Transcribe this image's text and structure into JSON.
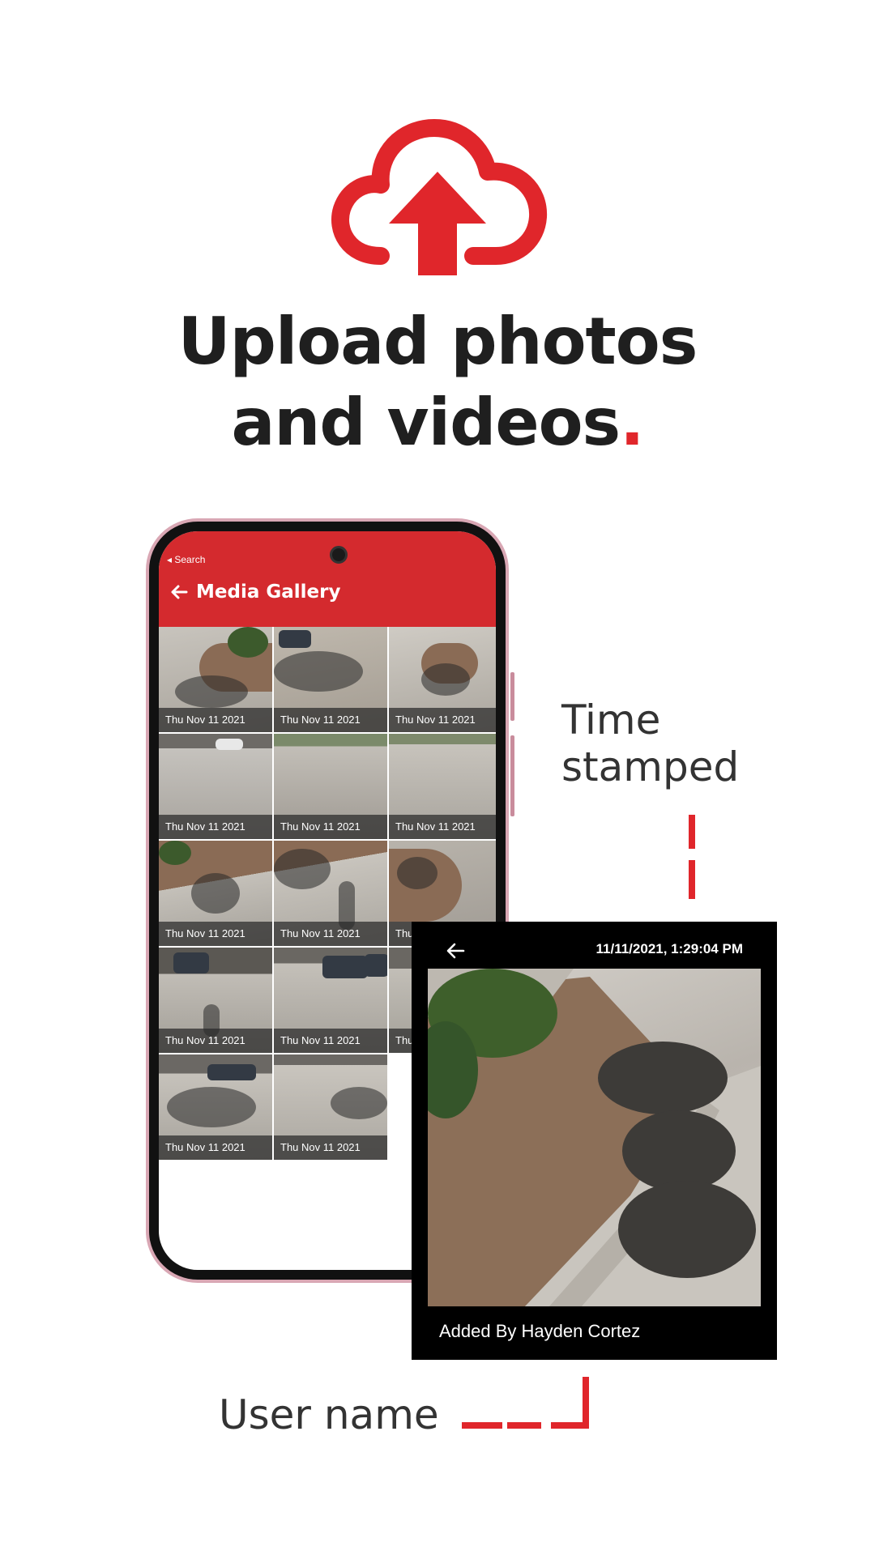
{
  "hero": {
    "icon": "cloud-upload-icon",
    "headline_line1": "Upload photos",
    "headline_line2": "and videos",
    "headline_dot": ".",
    "accent_color": "#e0262b"
  },
  "phone": {
    "status_back_label": "◂ Search",
    "header": {
      "back_icon": "arrow-left-icon",
      "title": "Media Gallery",
      "color": "#d42a2e"
    },
    "gallery": [
      {
        "date": "Thu Nov 11 2021"
      },
      {
        "date": "Thu Nov 11 2021"
      },
      {
        "date": "Thu Nov 11 2021"
      },
      {
        "date": "Thu Nov 11 2021"
      },
      {
        "date": "Thu Nov 11 2021"
      },
      {
        "date": "Thu Nov 11 2021"
      },
      {
        "date": "Thu Nov 11 2021"
      },
      {
        "date": "Thu Nov 11 2021"
      },
      {
        "date": "Thu Nov 11 2021"
      },
      {
        "date": "Thu Nov 11 2021"
      },
      {
        "date": "Thu Nov 11 2021"
      },
      {
        "date": "Thu"
      },
      {
        "date": "Thu Nov 11 2021"
      },
      {
        "date": "Thu Nov 11 2021"
      }
    ]
  },
  "callouts": {
    "time_line1": "Time",
    "time_line2": "stamped",
    "user": "User name"
  },
  "detail": {
    "back_icon": "arrow-left-icon",
    "timestamp": "11/11/2021, 1:29:04 PM",
    "added_by": "Added By Hayden Cortez"
  }
}
